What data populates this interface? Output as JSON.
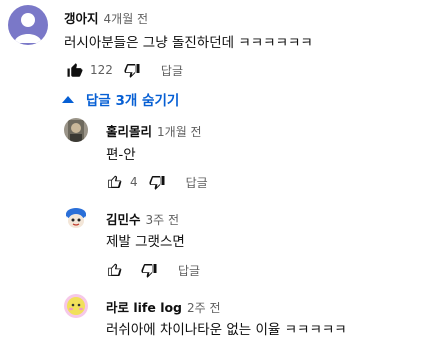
{
  "comment": {
    "author": "갱아지",
    "time": "4개월 전",
    "text": "러시아분들은 그냥 돌진하던데 ㅋㅋㅋㅋㅋㅋ",
    "likes": "122",
    "reply_label": "답글"
  },
  "replies_toggle": {
    "label": "답글 3개 숨기기"
  },
  "replies": [
    {
      "author": "홀리몰리",
      "time": "1개월 전",
      "text": "편-안",
      "likes": "4",
      "reply_label": "답글"
    },
    {
      "author": "김민수",
      "time": "3주 전",
      "text": "제발 그랫스면",
      "likes": "",
      "reply_label": "답글"
    },
    {
      "author": "라로 life log",
      "time": "2주 전",
      "text": "러쉬아에 차이나타운 없는 이율 ㅋㅋㅋㅋㅋ",
      "likes": "",
      "reply_label": "답글"
    }
  ],
  "colors": {
    "link_blue": "#065fd4",
    "secondary_text": "#606060",
    "avatar_purple": "#7a78c8"
  },
  "icons": [
    "like-icon",
    "dislike-icon",
    "chevron-up-icon"
  ]
}
